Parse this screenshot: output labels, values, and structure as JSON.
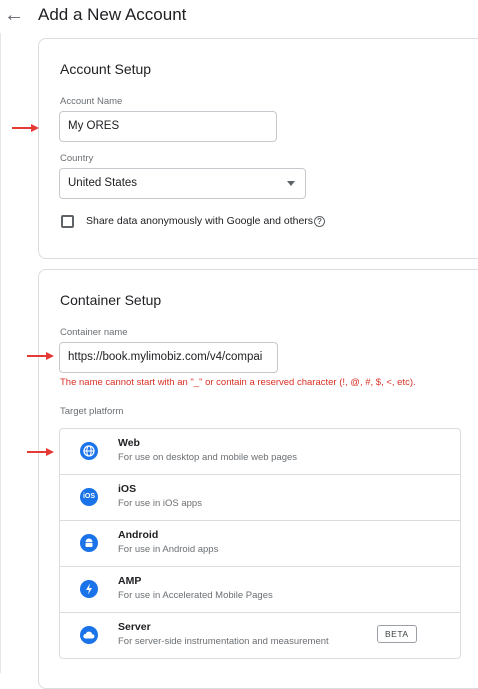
{
  "header": {
    "back_icon": "←",
    "title": "Add a New Account"
  },
  "account_setup": {
    "title": "Account Setup",
    "account_name_label": "Account Name",
    "account_name_value": "My ORES",
    "country_label": "Country",
    "country_value": "United States",
    "share_label": "Share data anonymously with Google and others",
    "help_icon": "?"
  },
  "container_setup": {
    "title": "Container Setup",
    "container_name_label": "Container name",
    "container_name_value": "https://book.mylimobiz.com/v4/compai",
    "error": "The name cannot start with an \"_\" or contain a reserved character (!, @, #, $, <, etc).",
    "target_platform_label": "Target platform",
    "platforms": [
      {
        "name": "Web",
        "desc": "For use on desktop and mobile web pages",
        "icon": "globe-icon",
        "glyph": ""
      },
      {
        "name": "iOS",
        "desc": "For use in iOS apps",
        "icon": "ios-icon",
        "glyph": "iOS"
      },
      {
        "name": "Android",
        "desc": "For use in Android apps",
        "icon": "android-icon",
        "glyph": ""
      },
      {
        "name": "AMP",
        "desc": "For use in Accelerated Mobile Pages",
        "icon": "lightning-icon",
        "glyph": ""
      },
      {
        "name": "Server",
        "desc": "For server-side instrumentation and measurement",
        "icon": "cloud-icon",
        "glyph": "",
        "badge": "BETA"
      }
    ]
  },
  "colors": {
    "accent": "#1a73e8",
    "error": "#d93025",
    "annotation_arrow": "#e53935"
  }
}
